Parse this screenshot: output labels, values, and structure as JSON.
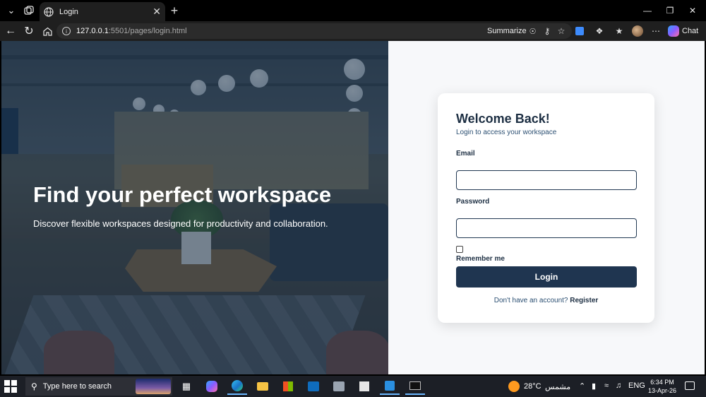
{
  "browser": {
    "tab_title": "Login",
    "url_host": "127.0.0.1",
    "url_path": ":5501/pages/login.html",
    "summarize_label": "Summarize",
    "chat_label": "Chat"
  },
  "hero": {
    "heading": "Find your perfect workspace",
    "tagline": "Discover flexible workspaces designed for productivity and collaboration."
  },
  "login": {
    "heading": "Welcome Back!",
    "subheading": "Login to access your workspace",
    "email_label": "Email",
    "email_value": "",
    "password_label": "Password",
    "password_value": "",
    "remember_label": "Remember me",
    "remember_checked": false,
    "submit_label": "Login",
    "register_prompt": "Don't have an account?",
    "register_link": "Register",
    "colors": {
      "primary": "#1f3550",
      "text": "#1d2f43",
      "muted": "#2b4f72"
    }
  },
  "taskbar": {
    "search_placeholder": "Type here to search",
    "weather_temp": "28°C",
    "weather_condition": "مشمس",
    "language": "ENG",
    "time": "6:34 PM",
    "date": "13-Apr-26"
  }
}
